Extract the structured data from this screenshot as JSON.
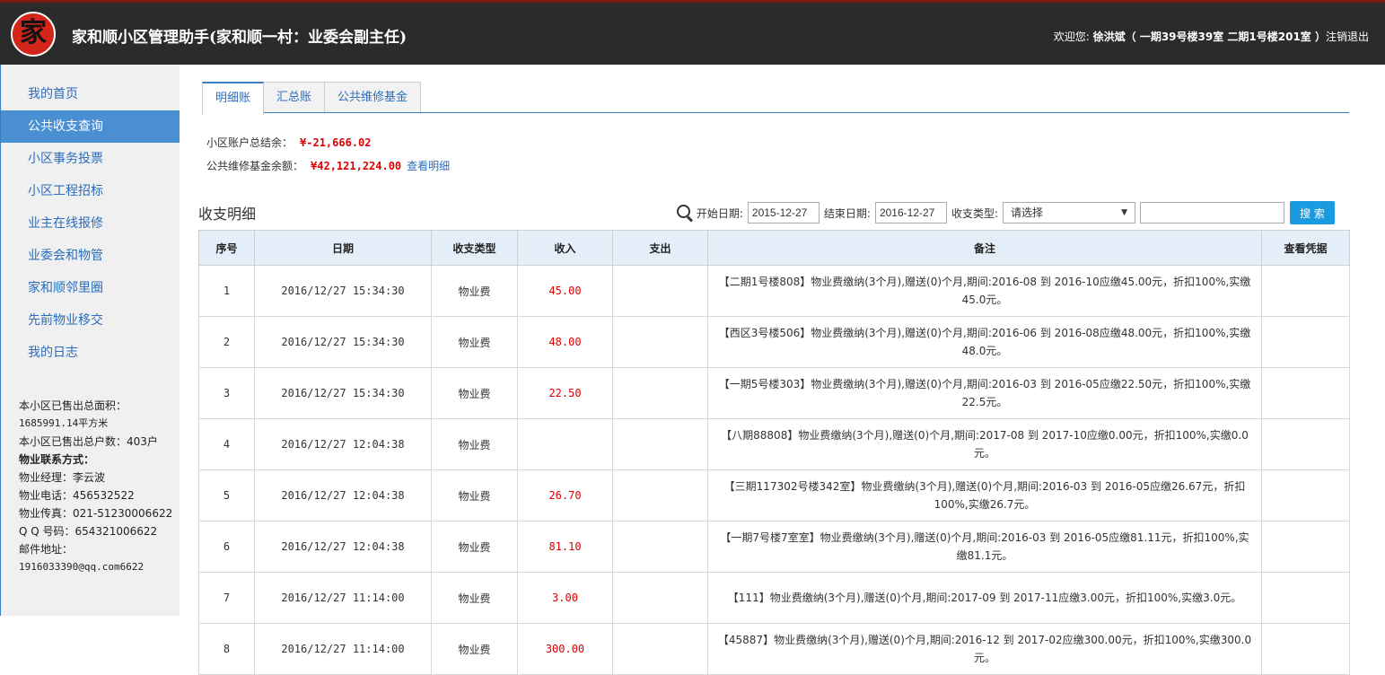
{
  "header": {
    "logo_char": "家",
    "title": "家和顺小区管理助手(家和顺一村：业委会副主任)",
    "welcome_prefix": "欢迎您: ",
    "user_name": "徐洪斌",
    "address": "（ 一期39号楼39室   二期1号楼201室 ）",
    "logout": "注销退出"
  },
  "sidebar": {
    "items": [
      {
        "label": "我的首页"
      },
      {
        "label": "公共收支查询"
      },
      {
        "label": "小区事务投票"
      },
      {
        "label": "小区工程招标"
      },
      {
        "label": "业主在线报修"
      },
      {
        "label": "业委会和物管"
      },
      {
        "label": "家和顺邻里圈"
      },
      {
        "label": "先前物业移交"
      },
      {
        "label": "我的日志"
      }
    ],
    "info": {
      "area_label": "本小区已售出总面积：",
      "area_value": "1685991.14平方米",
      "households": "本小区已售出总户数：403户",
      "contact_heading": "物业联系方式：",
      "manager": "物业经理：李云波",
      "phone": "物业电话：456532522",
      "fax": "物业传真：021-51230006622",
      "qq": "Q Q 号码：654321006622",
      "email_label": "邮件地址：",
      "email_value": "1916033390@qq.com6622"
    }
  },
  "tabs": [
    {
      "label": "明细账"
    },
    {
      "label": "汇总账"
    },
    {
      "label": "公共维修基金"
    }
  ],
  "balances": {
    "total_label": "小区账户总结余：",
    "total_value": "¥-21,666.02",
    "fund_label": "公共维修基金余额：",
    "fund_value": "¥42,121,224.00",
    "fund_link": "查看明细"
  },
  "section_title": "收支明细",
  "filters": {
    "start_label": "开始日期:",
    "start_value": "2015-12-27",
    "end_label": "结束日期:",
    "end_value": "2016-12-27",
    "type_label": "收支类型:",
    "type_value": "请选择",
    "keyword_value": "",
    "search_button": "搜 索"
  },
  "table": {
    "headers": [
      "序号",
      "日期",
      "收支类型",
      "收入",
      "支出",
      "备注",
      "查看凭据"
    ],
    "rows": [
      {
        "no": "1",
        "date": "2016/12/27 15:34:30",
        "type": "物业费",
        "income": "45.00",
        "expense": "",
        "note": "【二期1号楼808】物业费缴纳(3个月),赠送(0)个月,期间:2016-08 到 2016-10应缴45.00元，折扣100%,实缴45.0元。",
        "voucher": ""
      },
      {
        "no": "2",
        "date": "2016/12/27 15:34:30",
        "type": "物业费",
        "income": "48.00",
        "expense": "",
        "note": "【西区3号楼506】物业费缴纳(3个月),赠送(0)个月,期间:2016-06 到 2016-08应缴48.00元，折扣100%,实缴48.0元。",
        "voucher": ""
      },
      {
        "no": "3",
        "date": "2016/12/27 15:34:30",
        "type": "物业费",
        "income": "22.50",
        "expense": "",
        "note": "【一期5号楼303】物业费缴纳(3个月),赠送(0)个月,期间:2016-03 到 2016-05应缴22.50元，折扣100%,实缴22.5元。",
        "voucher": ""
      },
      {
        "no": "4",
        "date": "2016/12/27 12:04:38",
        "type": "物业费",
        "income": "",
        "expense": "",
        "note": "【八期88808】物业费缴纳(3个月),赠送(0)个月,期间:2017-08 到 2017-10应缴0.00元，折扣100%,实缴0.0元。",
        "voucher": ""
      },
      {
        "no": "5",
        "date": "2016/12/27 12:04:38",
        "type": "物业费",
        "income": "26.70",
        "expense": "",
        "note": "【三期117302号楼342室】物业费缴纳(3个月),赠送(0)个月,期间:2016-03 到 2016-05应缴26.67元，折扣100%,实缴26.7元。",
        "voucher": ""
      },
      {
        "no": "6",
        "date": "2016/12/27 12:04:38",
        "type": "物业费",
        "income": "81.10",
        "expense": "",
        "note": "【一期7号楼7室室】物业费缴纳(3个月),赠送(0)个月,期间:2016-03 到 2016-05应缴81.11元，折扣100%,实缴81.1元。",
        "voucher": ""
      },
      {
        "no": "7",
        "date": "2016/12/27 11:14:00",
        "type": "物业费",
        "income": "3.00",
        "expense": "",
        "note": "【111】物业费缴纳(3个月),赠送(0)个月,期间:2017-09 到 2017-11应缴3.00元，折扣100%,实缴3.0元。",
        "voucher": ""
      },
      {
        "no": "8",
        "date": "2016/12/27 11:14:00",
        "type": "物业费",
        "income": "300.00",
        "expense": "",
        "note": "【45887】物业费缴纳(3个月),赠送(0)个月,期间:2016-12 到 2017-02应缴300.00元，折扣100%,实缴300.0元。",
        "voucher": ""
      }
    ]
  },
  "colors": {
    "header_bg": "#2b2b2b",
    "accent": "#3a7fc0",
    "active_nav": "#4a8fd2",
    "money_red": "#dd0000",
    "search_button": "#1a9ae0"
  }
}
